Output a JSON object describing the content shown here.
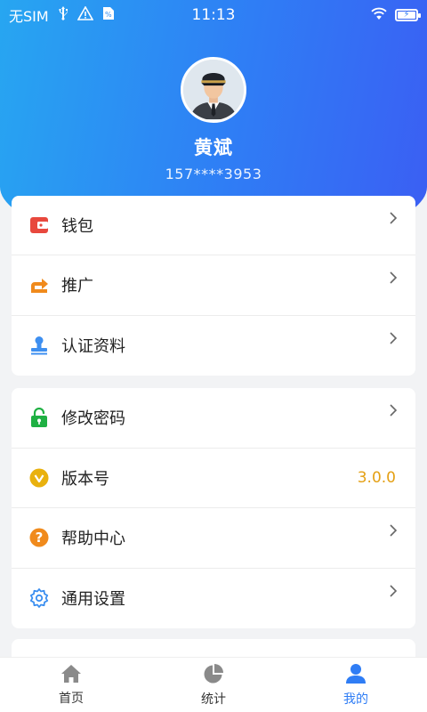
{
  "status_bar": {
    "carrier": "无SIM",
    "time": "11:13",
    "icons": [
      "usb-icon",
      "warning-icon",
      "sim-icon",
      "wifi-icon",
      "battery-charging-icon"
    ]
  },
  "profile": {
    "name": "黄斌",
    "phone": "157****3953"
  },
  "menu_group_1": [
    {
      "label": "钱包",
      "icon": "wallet-icon",
      "color": "#e8483d"
    },
    {
      "label": "推广",
      "icon": "share-icon",
      "color": "#f08a1c"
    },
    {
      "label": "认证资料",
      "icon": "stamp-icon",
      "color": "#3e8ff0"
    }
  ],
  "menu_group_2": [
    {
      "label": "修改密码",
      "icon": "lock-icon",
      "color": "#1fb043"
    },
    {
      "label": "版本号",
      "icon": "version-check-icon",
      "color": "#e9b10e",
      "value": "3.0.0"
    },
    {
      "label": "帮助中心",
      "icon": "help-icon",
      "color": "#f08a1c"
    },
    {
      "label": "通用设置",
      "icon": "gear-icon",
      "color": "#3a8ef0"
    }
  ],
  "tabbar": {
    "tabs": [
      {
        "label": "首页",
        "icon": "home-icon",
        "active": false
      },
      {
        "label": "统计",
        "icon": "pie-chart-icon",
        "active": false
      },
      {
        "label": "我的",
        "icon": "user-icon",
        "active": true
      }
    ],
    "active_color": "#2f7df5"
  },
  "colors": {
    "header_gradient_start": "#27a6f1",
    "header_gradient_end": "#3b5ef3",
    "version_value": "#e4a014"
  }
}
